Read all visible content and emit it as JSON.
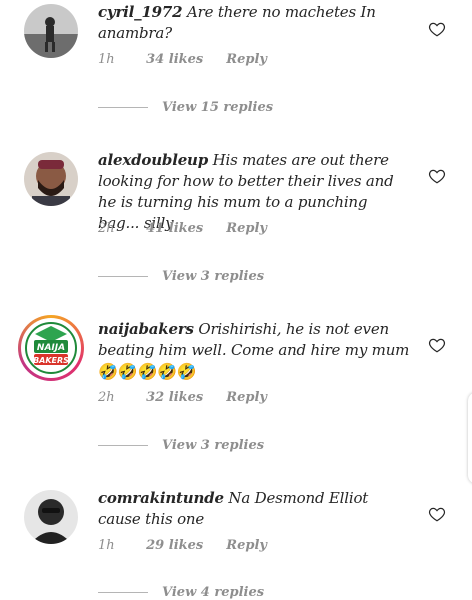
{
  "comments": [
    {
      "username": "cyril_1972",
      "text": "Are there no machetes In anambra?",
      "time": "1h",
      "likes": "34 likes",
      "reply": "Reply",
      "view_replies": "View 15 replies"
    },
    {
      "username": "alexdoubleup",
      "text": "His mates are out there looking for how to better their lives and he is turning his mum to a punching bag... silly",
      "time": "2h",
      "likes": "41 likes",
      "reply": "Reply",
      "view_replies": "View 3 replies"
    },
    {
      "username": "naijabakers",
      "text": "Orishirishi, he is not even beating him well. Come and hire my mum",
      "emoji": "🤣🤣🤣🤣🤣",
      "time": "2h",
      "likes": "32 likes",
      "reply": "Reply",
      "view_replies": "View 3 replies",
      "avatar_text_top": "NAIJA",
      "avatar_text_bottom": "BAKERS"
    },
    {
      "username": "comrakintunde",
      "text": "Na Desmond Elliot cause this one",
      "time": "1h",
      "likes": "29 likes",
      "reply": "Reply",
      "view_replies": "View 4 replies"
    }
  ],
  "colors": {
    "text": "#262626",
    "muted": "#8e8e8e",
    "story_ring": "#e1306c"
  },
  "icons": {
    "like": "heart-outline-icon"
  }
}
